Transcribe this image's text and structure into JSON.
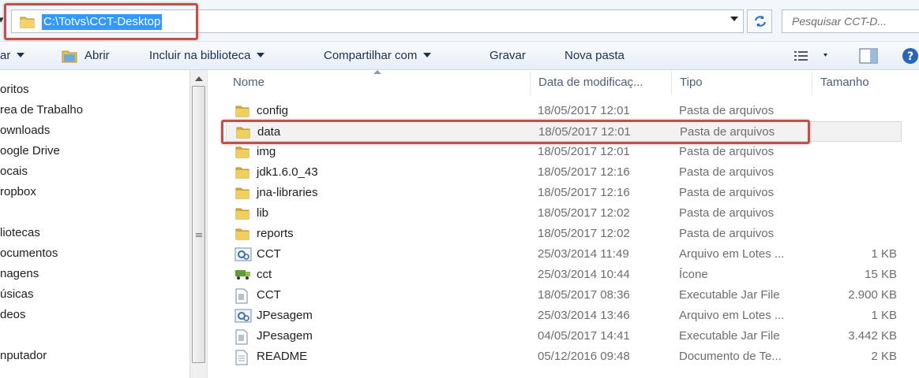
{
  "address": {
    "path": "C:\\Totvs\\CCT-Desktop",
    "search_placeholder": "Pesquisar CCT-D..."
  },
  "toolbar": {
    "organize_label": "ar",
    "open_label": "Abrir",
    "include_label": "Incluir na biblioteca",
    "share_label": "Compartilhar com",
    "burn_label": "Gravar",
    "new_folder_label": "Nova pasta"
  },
  "nav": {
    "items": [
      {
        "label": "oritos"
      },
      {
        "label": "rea de Trabalho"
      },
      {
        "label": "ownloads"
      },
      {
        "label": "oogle Drive"
      },
      {
        "label": "ocais"
      },
      {
        "label": "ropbox"
      },
      {
        "label": "liotecas"
      },
      {
        "label": "ocumentos"
      },
      {
        "label": "nagens"
      },
      {
        "label": "úsicas"
      },
      {
        "label": "deos"
      },
      {
        "label": "nputador"
      }
    ]
  },
  "columns": {
    "name": "Nome",
    "date": "Data de modificaç...",
    "type": "Tipo",
    "size": "Tamanho"
  },
  "files": [
    {
      "name": "config",
      "date": "18/05/2017 12:01",
      "type": "Pasta de arquivos",
      "size": "",
      "icon": "folder-icon"
    },
    {
      "name": "data",
      "date": "18/05/2017 12:01",
      "type": "Pasta de arquivos",
      "size": "",
      "icon": "folder-icon"
    },
    {
      "name": "img",
      "date": "18/05/2017 12:01",
      "type": "Pasta de arquivos",
      "size": "",
      "icon": "folder-icon"
    },
    {
      "name": "jdk1.6.0_43",
      "date": "18/05/2017 12:16",
      "type": "Pasta de arquivos",
      "size": "",
      "icon": "folder-icon"
    },
    {
      "name": "jna-libraries",
      "date": "18/05/2017 12:16",
      "type": "Pasta de arquivos",
      "size": "",
      "icon": "folder-icon"
    },
    {
      "name": "lib",
      "date": "18/05/2017 12:02",
      "type": "Pasta de arquivos",
      "size": "",
      "icon": "folder-icon"
    },
    {
      "name": "reports",
      "date": "18/05/2017 12:02",
      "type": "Pasta de arquivos",
      "size": "",
      "icon": "folder-icon"
    },
    {
      "name": "CCT",
      "date": "25/03/2014 11:49",
      "type": "Arquivo em Lotes ...",
      "size": "1 KB",
      "icon": "batch-file-icon"
    },
    {
      "name": "cct",
      "date": "25/03/2014 10:44",
      "type": "Ícone",
      "size": "15 KB",
      "icon": "truck-icon"
    },
    {
      "name": "CCT",
      "date": "18/05/2017 08:36",
      "type": "Executable Jar File",
      "size": "2.900 KB",
      "icon": "jar-file-icon"
    },
    {
      "name": "JPesagem",
      "date": "25/03/2014 13:46",
      "type": "Arquivo em Lotes ...",
      "size": "1 KB",
      "icon": "batch-file-icon"
    },
    {
      "name": "JPesagem",
      "date": "04/05/2017 14:41",
      "type": "Executable Jar File",
      "size": "3.442 KB",
      "icon": "jar-file-icon"
    },
    {
      "name": "README",
      "date": "05/12/2016 09:48",
      "type": "Documento de Te...",
      "size": "2 KB",
      "icon": "text-file-icon"
    }
  ],
  "colors": {
    "highlight_box": "#c0504d",
    "selection_blue": "#3399ff",
    "folder_yellow": "#e8c04a"
  }
}
